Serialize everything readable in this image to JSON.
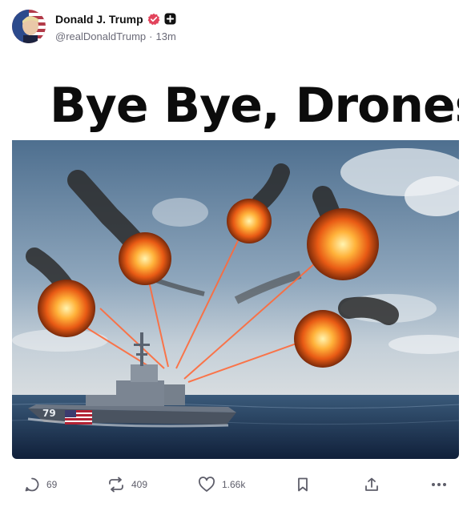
{
  "author": {
    "display_name": "Donald J. Trump",
    "handle": "@realDonaldTrump",
    "separator": "·",
    "time": "13m",
    "verified_badge": "verified-badge-icon",
    "plus_badge": "plus-badge-icon"
  },
  "media": {
    "title": "Bye Bye, Drones",
    "hull_number": "79"
  },
  "actions": {
    "replies": "69",
    "retruths": "409",
    "likes": "1.66k",
    "reply_icon": "reply-icon",
    "retruth_icon": "retruth-icon",
    "like_icon": "heart-icon",
    "save_icon": "bookmark-icon",
    "share_icon": "share-icon",
    "more_icon": "more-icon"
  },
  "colors": {
    "accent": "#e2445c",
    "text_primary": "#111111",
    "text_secondary": "#6b6b78",
    "laser": "#ff6a3a"
  }
}
